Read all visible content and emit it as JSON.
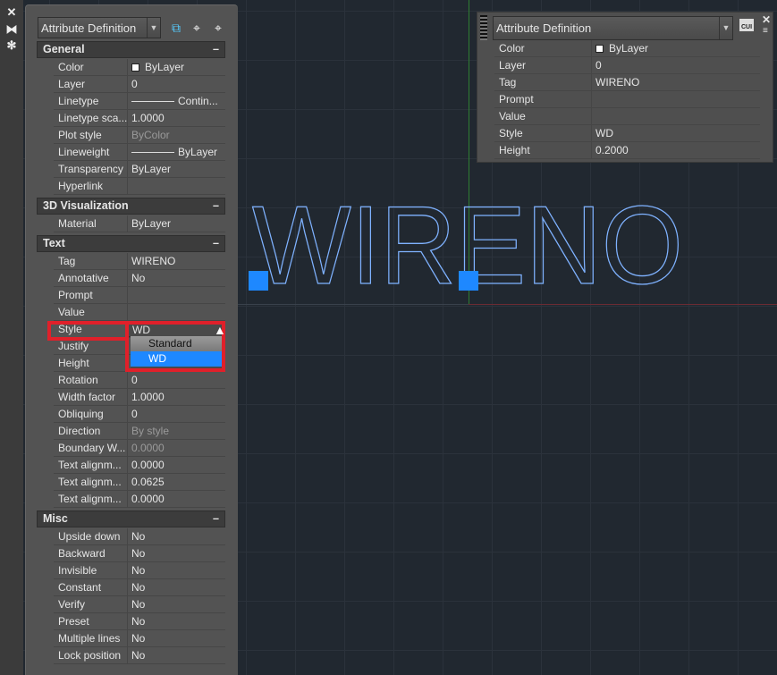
{
  "colors": {
    "accent": "#1e88ff",
    "highlight": "#e0202a",
    "drawing_text": "#7fb2ff"
  },
  "drawing": {
    "text": "WIRENO"
  },
  "side_strip": {
    "icons": [
      "close-icon",
      "auto-hide-icon",
      "properties-settings-icon"
    ]
  },
  "palette": {
    "selector": "Attribute Definition",
    "toolbar": [
      "toggle-pickadd-icon",
      "select-objects-icon",
      "quick-select-icon"
    ],
    "sections": [
      {
        "title": "General",
        "rows": [
          {
            "label": "Color",
            "value": "ByLayer",
            "swatch": true
          },
          {
            "label": "Layer",
            "value": "0"
          },
          {
            "label": "Linetype",
            "value": "Contin...",
            "line": true
          },
          {
            "label": "Linetype sca...",
            "value": "1.0000"
          },
          {
            "label": "Plot style",
            "value": "ByColor",
            "dim": true
          },
          {
            "label": "Lineweight",
            "value": "ByLayer",
            "line": true
          },
          {
            "label": "Transparency",
            "value": "ByLayer"
          },
          {
            "label": "Hyperlink",
            "value": ""
          }
        ]
      },
      {
        "title": "3D Visualization",
        "rows": [
          {
            "label": "Material",
            "value": "ByLayer"
          }
        ]
      },
      {
        "title": "Text",
        "rows": [
          {
            "label": "Tag",
            "value": "WIRENO"
          },
          {
            "label": "Annotative",
            "value": "No"
          },
          {
            "label": "Prompt",
            "value": ""
          },
          {
            "label": "Value",
            "value": ""
          },
          {
            "label": "Style",
            "value": "WD"
          },
          {
            "label": "Justify",
            "value": ""
          },
          {
            "label": "Height",
            "value": ""
          },
          {
            "label": "Rotation",
            "value": "0"
          },
          {
            "label": "Width factor",
            "value": "1.0000"
          },
          {
            "label": "Obliquing",
            "value": "0"
          },
          {
            "label": "Direction",
            "value": "By style",
            "dim": true
          },
          {
            "label": "Boundary W...",
            "value": "0.0000",
            "dim": true
          },
          {
            "label": "Text alignm...",
            "value": "0.0000"
          },
          {
            "label": "Text alignm...",
            "value": "0.0625"
          },
          {
            "label": "Text alignm...",
            "value": "0.0000"
          }
        ]
      },
      {
        "title": "Misc",
        "rows": [
          {
            "label": "Upside down",
            "value": "No"
          },
          {
            "label": "Backward",
            "value": "No"
          },
          {
            "label": "Invisible",
            "value": "No"
          },
          {
            "label": "Constant",
            "value": "No"
          },
          {
            "label": "Verify",
            "value": "No"
          },
          {
            "label": "Preset",
            "value": "No"
          },
          {
            "label": "Multiple lines",
            "value": "No"
          },
          {
            "label": "Lock position",
            "value": "No"
          }
        ]
      }
    ],
    "style_dropdown": {
      "options": [
        "Standard",
        "WD"
      ],
      "selected": "WD"
    }
  },
  "quick_properties": {
    "selector": "Attribute Definition",
    "rows": [
      {
        "label": "Color",
        "value": "ByLayer",
        "swatch": true
      },
      {
        "label": "Layer",
        "value": "0"
      },
      {
        "label": "Tag",
        "value": "WIRENO"
      },
      {
        "label": "Prompt",
        "value": ""
      },
      {
        "label": "Value",
        "value": ""
      },
      {
        "label": "Style",
        "value": "WD"
      },
      {
        "label": "Height",
        "value": "0.2000"
      }
    ]
  }
}
